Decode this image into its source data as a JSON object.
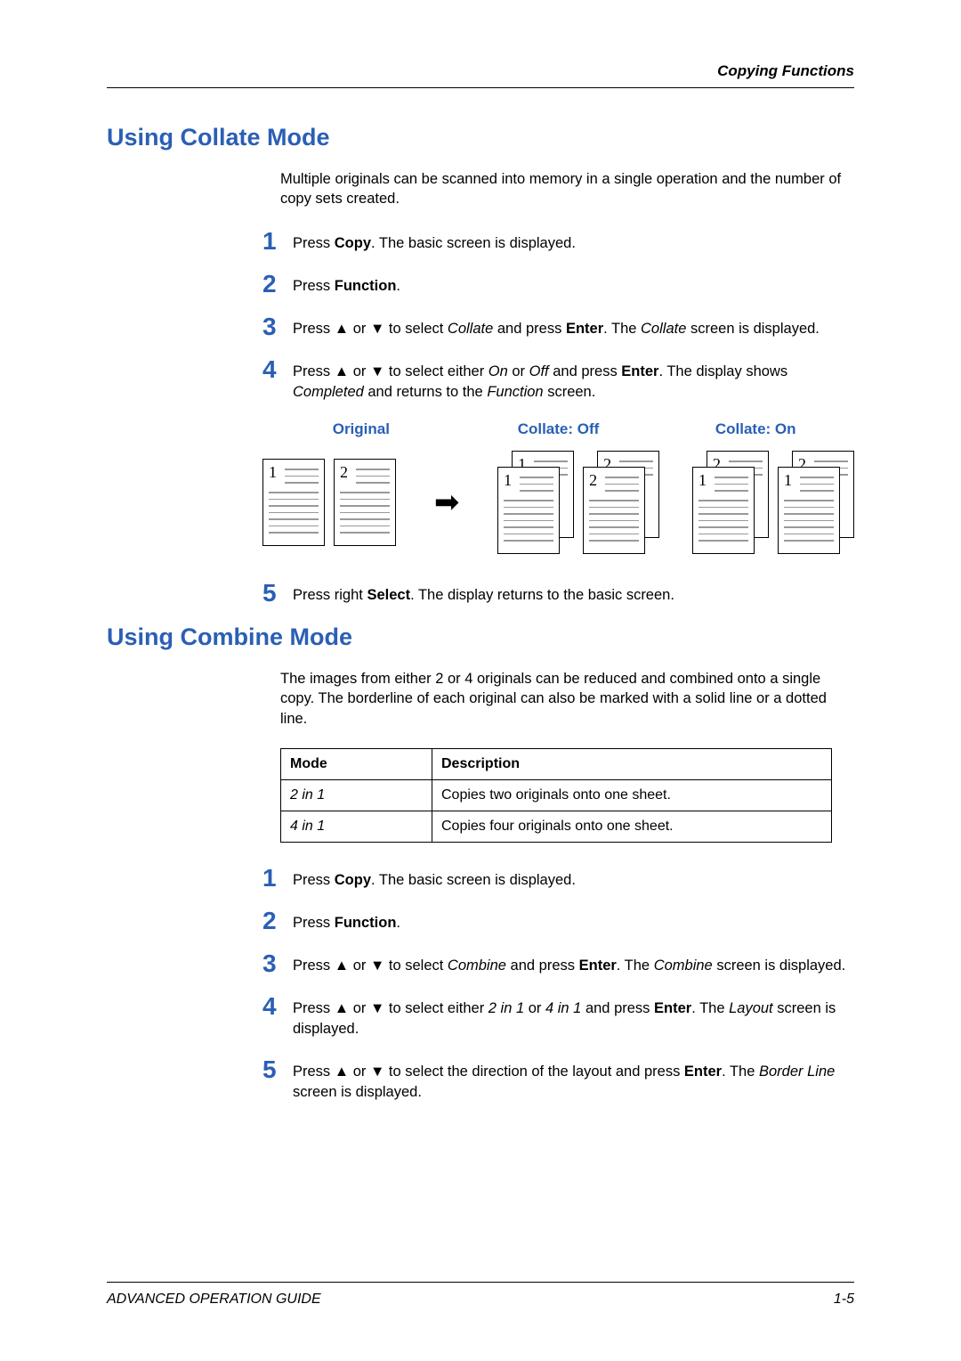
{
  "header": {
    "category": "Copying Functions"
  },
  "collate": {
    "heading": "Using Collate Mode",
    "intro": "Multiple originals can be scanned into memory in a single operation and the number of copy sets created.",
    "steps": {
      "s1_a": "Press ",
      "s1_b": "Copy",
      "s1_c": ". The basic screen is displayed.",
      "s2_a": "Press ",
      "s2_b": "Function",
      "s2_c": ".",
      "s3_a": "Press ",
      "s3_b": " or ",
      "s3_c": " to select ",
      "s3_d": "Collate",
      "s3_e": " and press ",
      "s3_f": "Enter",
      "s3_g": ". The ",
      "s3_h": "Collate",
      "s3_i": " screen is displayed.",
      "s4_a": "Press ",
      "s4_b": " or ",
      "s4_c": " to select either ",
      "s4_d": "On",
      "s4_e": " or ",
      "s4_f": "Off",
      "s4_g": " and press ",
      "s4_h": "Enter",
      "s4_i": ". The display shows ",
      "s4_j": "Completed",
      "s4_k": " and returns to the ",
      "s4_l": "Function",
      "s4_m": " screen.",
      "s5_a": "Press right ",
      "s5_b": "Select",
      "s5_c": ". The display returns to the basic screen."
    },
    "diagram": {
      "label_original": "Original",
      "label_off": "Collate: Off",
      "label_on": "Collate: On"
    }
  },
  "combine": {
    "heading": "Using Combine Mode",
    "intro": "The images from either 2 or 4 originals can be reduced and combined onto a single copy. The borderline of each original can also be marked with a solid line or a dotted line.",
    "table": {
      "th_mode": "Mode",
      "th_desc": "Description",
      "r1_mode": "2 in 1",
      "r1_desc": "Copies two originals onto one sheet.",
      "r2_mode": "4 in 1",
      "r2_desc": "Copies four originals onto one sheet."
    },
    "steps": {
      "s1_a": "Press ",
      "s1_b": "Copy",
      "s1_c": ". The basic screen is displayed.",
      "s2_a": "Press ",
      "s2_b": "Function",
      "s2_c": ".",
      "s3_a": "Press ",
      "s3_b": " or ",
      "s3_c": " to select ",
      "s3_d": "Combine",
      "s3_e": " and press ",
      "s3_f": "Enter",
      "s3_g": ". The ",
      "s3_h": "Combine",
      "s3_i": " screen is displayed.",
      "s4_a": "Press ",
      "s4_b": " or ",
      "s4_c": " to select either ",
      "s4_d": "2 in 1",
      "s4_e": " or ",
      "s4_f": "4 in 1",
      "s4_g": " and press ",
      "s4_h": "Enter",
      "s4_i": ". The ",
      "s4_j": "Layout",
      "s4_k": " screen is displayed.",
      "s5_a": "Press ",
      "s5_b": " or ",
      "s5_c": " to select the direction of the layout and press ",
      "s5_d": "Enter",
      "s5_e": ". The ",
      "s5_f": "Border Line",
      "s5_g": " screen is displayed."
    }
  },
  "footer": {
    "left": "ADVANCED OPERATION GUIDE",
    "right": "1-5"
  },
  "nums": {
    "n1": "1",
    "n2": "2",
    "n3": "3",
    "n4": "4",
    "n5": "5"
  },
  "glyph": {
    "up": "▲",
    "down": "▼",
    "arrow": "➡"
  }
}
